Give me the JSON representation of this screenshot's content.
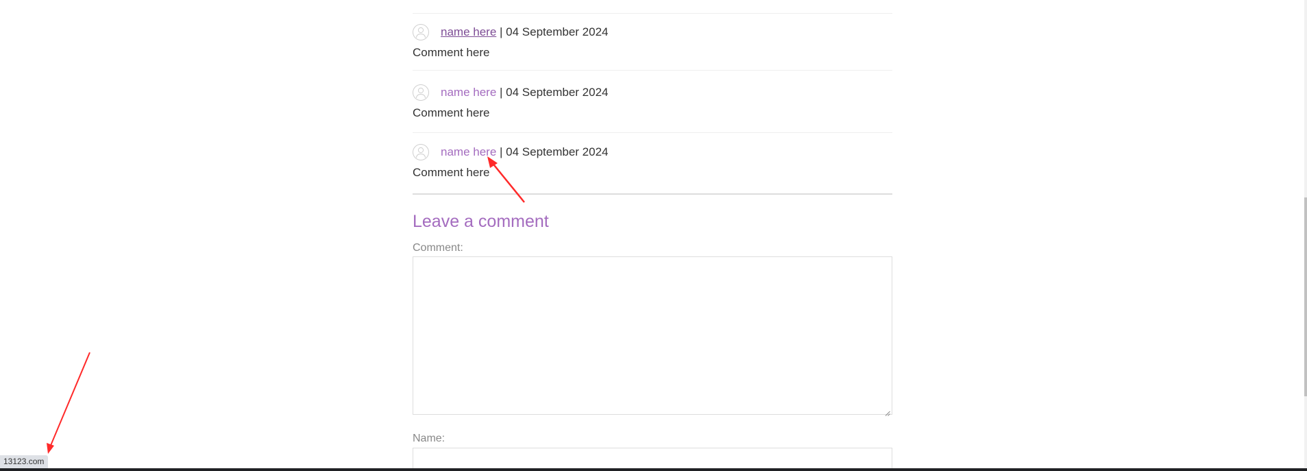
{
  "comments": [
    {
      "author": "name here",
      "separator": " | ",
      "date": "04 September 2024",
      "text": "Comment here",
      "link_state": "visited"
    },
    {
      "author": "name here",
      "separator": " | ",
      "date": "04 September 2024",
      "text": "Comment here",
      "link_state": "default"
    },
    {
      "author": "name here",
      "separator": " | ",
      "date": "04 September 2024",
      "text": "Comment here",
      "link_state": "default"
    }
  ],
  "form": {
    "title": "Leave a comment",
    "comment_label": "Comment:",
    "comment_value": "",
    "name_label": "Name:",
    "name_value": ""
  },
  "status_bar": {
    "url": "13123.com"
  },
  "colors": {
    "accent": "#a46cbf",
    "visited_link": "#7d4c95",
    "text": "#333333",
    "label": "#888888",
    "annotation_arrow": "#ff2a2a"
  },
  "icons": {
    "avatar": "user-avatar-icon"
  }
}
